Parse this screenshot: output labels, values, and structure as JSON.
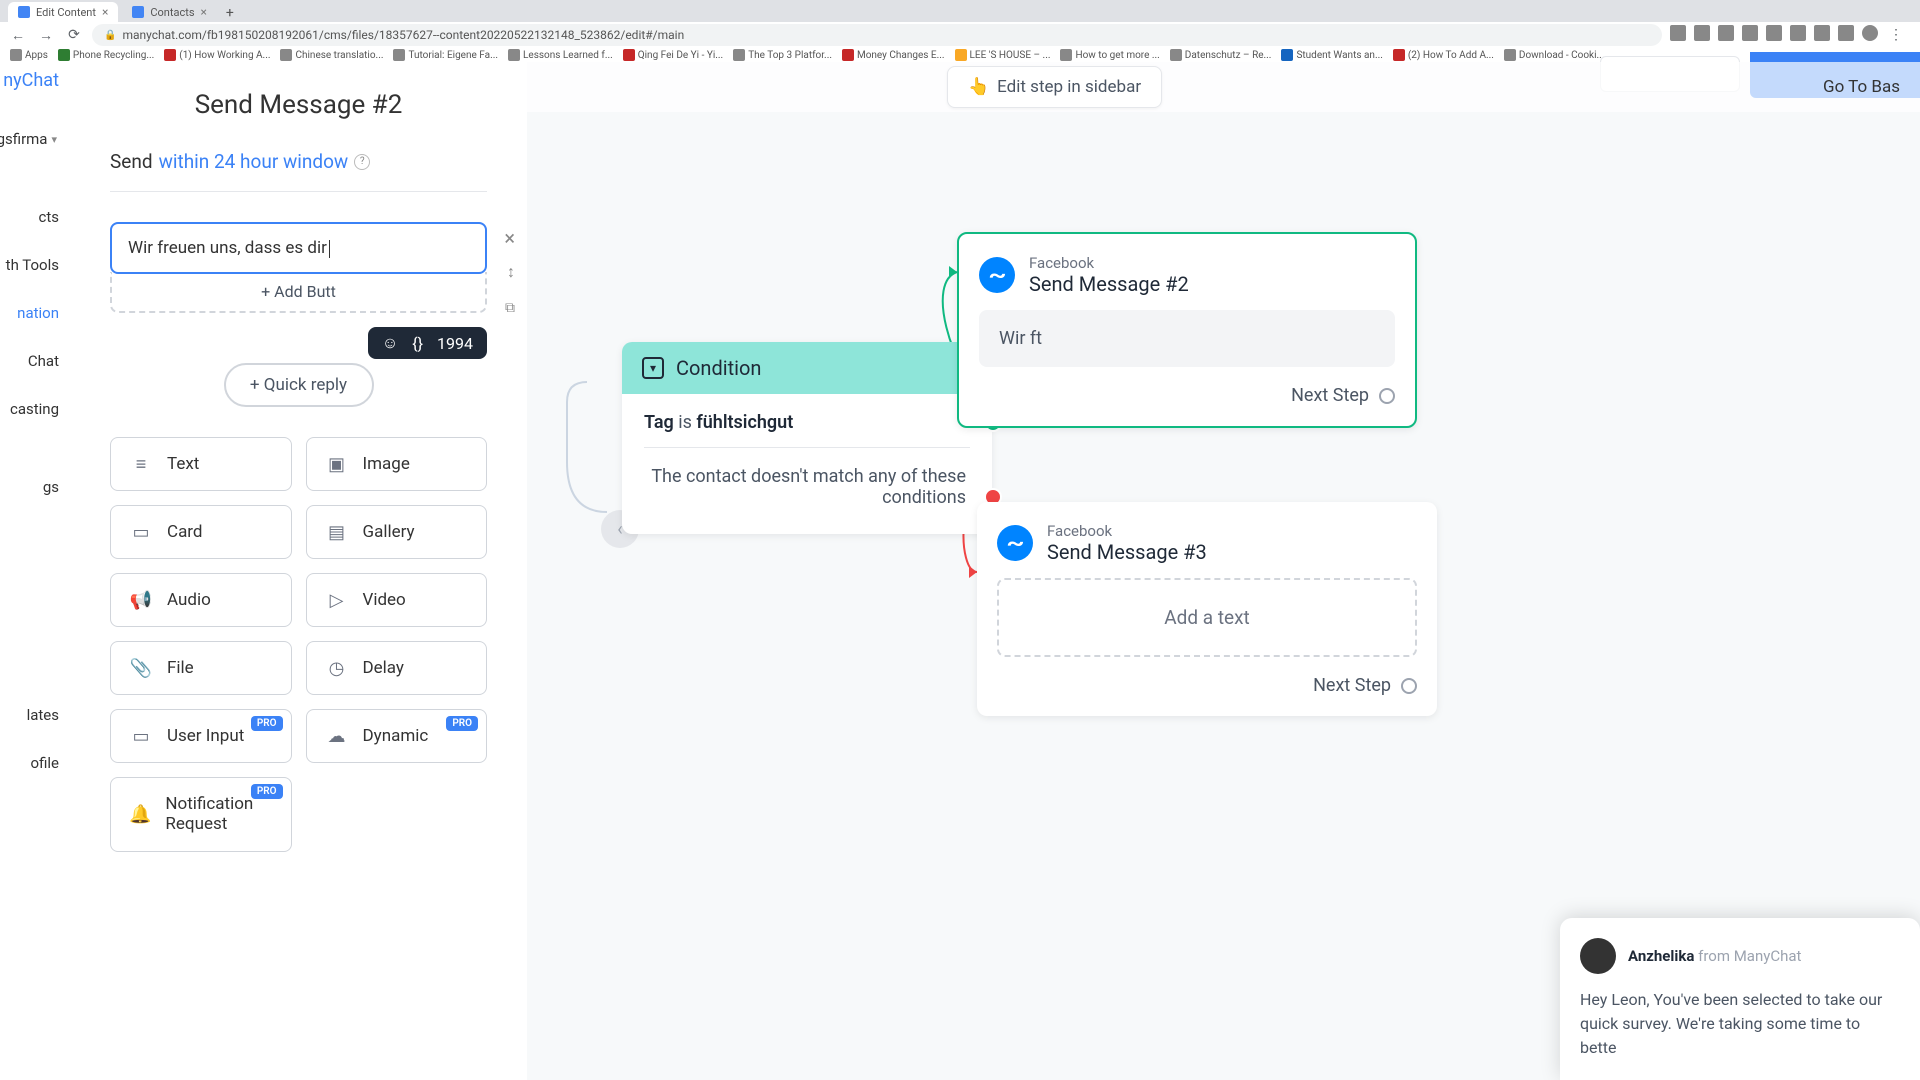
{
  "browser": {
    "tabs": [
      {
        "title": "Edit Content",
        "active": true
      },
      {
        "title": "Contacts",
        "active": false
      }
    ],
    "url": "manychat.com/fb198150208192061/cms/files/18357627--content20220522132148_523862/edit#/main",
    "bookmarks": [
      "Apps",
      "Phone Recycling...",
      "(1) How Working A...",
      "Chinese translatio...",
      "Tutorial: Eigene Fa...",
      "Lessons Learned f...",
      "Qing Fei De Yi - Yi...",
      "The Top 3 Platfor...",
      "Money Changes E...",
      "LEE 'S HOUSE – ...",
      "How to get more ...",
      "Datenschutz – Re...",
      "Student Wants an...",
      "(2) How To Add A...",
      "Download - Cooki..."
    ]
  },
  "sidebar": {
    "brand_fragment": "nyChat",
    "workspace": "gsfirma",
    "items": [
      "cts",
      "th Tools",
      "nation",
      "Chat",
      "casting",
      "gs",
      "lates",
      "ofile"
    ],
    "active_index": 2
  },
  "editor": {
    "title": "Send Message #2",
    "send_label": "Send",
    "send_window": "within 24 hour window",
    "message_text": "Wir freuen uns, dass es dir",
    "char_count": "1994",
    "add_button": "+ Add Butt",
    "quick_reply": "+ Quick reply",
    "blocks": [
      {
        "label": "Text"
      },
      {
        "label": "Image"
      },
      {
        "label": "Card"
      },
      {
        "label": "Gallery"
      },
      {
        "label": "Audio"
      },
      {
        "label": "Video"
      },
      {
        "label": "File"
      },
      {
        "label": "Delay"
      },
      {
        "label": "User Input",
        "pro": true
      },
      {
        "label": "Dynamic",
        "pro": true
      },
      {
        "label": "Notification Request",
        "pro": true
      }
    ],
    "pro_label": "PRO"
  },
  "canvas": {
    "edit_step": "Edit step in sidebar",
    "goto": "Go To Bas",
    "condition": {
      "title": "Condition",
      "rule_field": "Tag",
      "rule_op": "is",
      "rule_value": "fühltsichgut",
      "fallback": "The contact doesn't match any of these conditions"
    },
    "node1": {
      "channel": "Facebook",
      "title": "Send Message #2",
      "preview": "Wir ft",
      "next": "Next Step"
    },
    "node2": {
      "channel": "Facebook",
      "title": "Send Message #3",
      "placeholder": "Add a text",
      "next": "Next Step"
    }
  },
  "chat": {
    "name": "Anzhelika",
    "from": "from ManyChat",
    "body": "Hey Leon, You've been selected to take our quick survey. We're taking some time to bette"
  }
}
